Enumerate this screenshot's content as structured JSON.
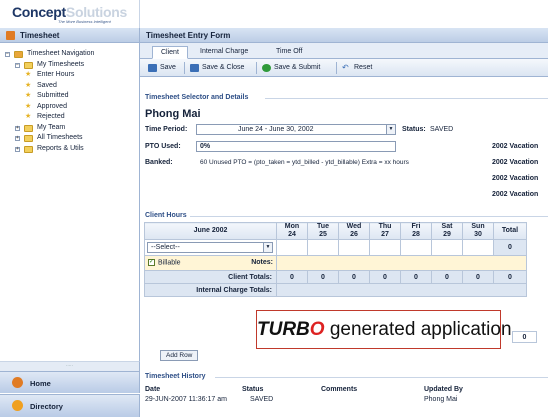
{
  "logo": {
    "brand_a": "Concept",
    "brand_b": "Solutions",
    "tagline": "The More Business Intelligent"
  },
  "sidebar": {
    "header": "Timesheet",
    "tree": [
      {
        "label": "Timesheet Navigation"
      },
      {
        "label": "My Timesheets"
      },
      {
        "label": "Enter Hours"
      },
      {
        "label": "Saved"
      },
      {
        "label": "Submitted"
      },
      {
        "label": "Approved"
      },
      {
        "label": "Rejected"
      },
      {
        "label": "My Team"
      },
      {
        "label": "All Timesheets"
      },
      {
        "label": "Reports & Utils"
      }
    ],
    "splitter": ".....",
    "home_label": "Home",
    "directory_label": "Directory"
  },
  "form": {
    "title": "Timesheet Entry Form",
    "tabs": [
      "Client",
      "Internal Charge",
      "Time Off"
    ],
    "toolbar": {
      "save": "Save",
      "save_close": "Save & Close",
      "save_submit": "Save & Submit",
      "reset": "Reset"
    },
    "selector_title": "Timesheet Selector and Details",
    "employee": "Phong Mai",
    "time_period_label": "Time Period:",
    "time_period_value": "June 24 - June 30, 2002",
    "status_label": "Status:",
    "status_value": "SAVED",
    "pto_label": "PTO Used:",
    "pto_value": "0%",
    "banked_label": "Banked:",
    "banked_value": "60 Unused PTO = (pto_taken = ytd_billed - ytd_billable) Extra = xx hours",
    "vacation": [
      "2002 Vacation",
      "2002 Vacation",
      "2002 Vacation",
      "2002 Vacation"
    ]
  },
  "hours": {
    "title": "Client Hours",
    "month": "June 2002",
    "days": [
      {
        "d": "Mon",
        "n": "24"
      },
      {
        "d": "Tue",
        "n": "25"
      },
      {
        "d": "Wed",
        "n": "26"
      },
      {
        "d": "Thu",
        "n": "27"
      },
      {
        "d": "Fri",
        "n": "28"
      },
      {
        "d": "Sat",
        "n": "29"
      },
      {
        "d": "Sun",
        "n": "30"
      }
    ],
    "total_label": "Total",
    "select_placeholder": "--Select--",
    "billable_label": "Billable",
    "notes_label": "Notes:",
    "row_total": "0",
    "client_totals_label": "Client Totals:",
    "client_totals": [
      "0",
      "0",
      "0",
      "0",
      "0",
      "0",
      "0",
      "0"
    ],
    "internal_label": "Internal Charge Totals:",
    "grand_total": "0",
    "add_row_label": "Add Row"
  },
  "overlay": {
    "turb": "TURB",
    "o": "O",
    "rest": " generated application"
  },
  "history": {
    "title": "Timesheet History",
    "headers": {
      "date": "Date",
      "status": "Status",
      "comments": "Comments",
      "updated_by": "Updated By"
    },
    "rows": [
      {
        "date": "29-JUN-2007 11:36:17 am",
        "status": "SAVED",
        "comments": "",
        "updated_by": "Phong Mai"
      }
    ]
  },
  "colors": {
    "accent": "#2d4e86",
    "header_bg": "#bccde6",
    "warning_border": "#c0392b",
    "turbo_o": "#dd2222"
  }
}
